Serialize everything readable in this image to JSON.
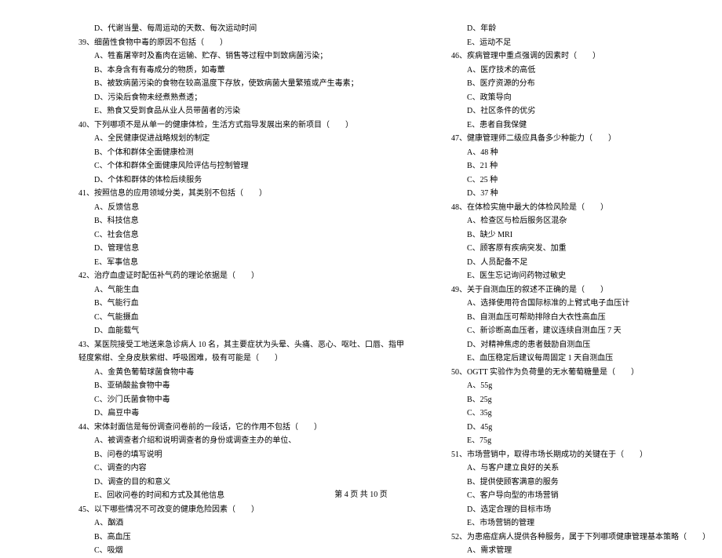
{
  "left": {
    "l0": "D、代谢当量、每周运动的天数、每次运动时间",
    "q39": "39、细菌性食物中毒的原因不包括（　　）",
    "q39a": "A、牲畜屠宰时及畜肉在运输、贮存、销售等过程中到致病菌污染；",
    "q39b": "B、本身含有有毒成分的物质，如毒蕈",
    "q39c": "B、被致病菌污染的食物在较高温度下存放，使致病菌大量繁殖或产生毒素；",
    "q39d": "D、污染后食物未经煮熟煮透；",
    "q39e": "E、熟食又受到食品从业人员带菌者的污染",
    "q40": "40、下列哪项不是从单一的健康体检，生活方式指导发展出来的新项目（　　）",
    "q40a": "A、全民健康促进战略规划的制定",
    "q40b": "B、个体和群体全面健康检测",
    "q40c": "C、个体和群体全面健康风险评估与控制管理",
    "q40d": "D、个体和群体的体检后续服务",
    "q41": "41、按照信息的应用领域分类，其类别不包括（　　）",
    "q41a": "A、反馈信息",
    "q41b": "B、科技信息",
    "q41c": "C、社会信息",
    "q41d": "D、管理信息",
    "q41e": "E、军事信息",
    "q42": "42、治疗血虚证时配伍补气药的理论依据是（　　）",
    "q42a": "A、气能生血",
    "q42b": "B、气能行血",
    "q42c": "C、气能摄血",
    "q42d": "D、血能载气",
    "q43": "43、某医院接受工地送来急诊病人 10 名，其主要症状为头晕、头痛、恶心、呕吐、口唇、指甲",
    "q43cont": "轻度紫绀、全身皮肤紫绀、呼吸困难，极有可能是（　　）",
    "q43a": "A、金黄色葡萄球菌食物中毒",
    "q43b": "B、亚硝酸盐食物中毒",
    "q43c": "C、沙门氏菌食物中毒",
    "q43d": "D、扁豆中毒",
    "q44": "44、宋体封面信是每份调查问卷前的一段话，它的作用不包括（　　）",
    "q44a": "A、被调查者介绍和说明调查者的身份或调查主办的单位、",
    "q44b": "B、问卷的填写说明",
    "q44c": "C、调查的内容",
    "q44d": "D、调查的目的和意义",
    "q44e": "E、回收问卷的时间和方式及其他信息",
    "q45": "45、以下哪些情况不可改变的健康危险因素（　　）",
    "q45a": "A、酗酒",
    "q45b": "B、高血压",
    "q45c": "C、吸烟"
  },
  "right": {
    "r0": "D、年龄",
    "r1": "E、运动不足",
    "q46": "46、疾病管理中重点强调的因素时（　　）",
    "q46a": "A、医疗技术的高低",
    "q46b": "B、医疗资源的分布",
    "q46c": "C、政策导向",
    "q46d": "D、社区条件的优劣",
    "q46e": "E、患者自我保健",
    "q47": "47、健康管理师二级应具备多少种能力（　　）",
    "q47a": "A、48 种",
    "q47b": "B、21 种",
    "q47c": "C、25 种",
    "q47d": "D、37 种",
    "q48": "48、在体检实施中最大的体检风险是（　　）",
    "q48a": "A、检查区与检后服务区混杂",
    "q48b": "B、缺少 MRI",
    "q48c": "C、顾客原有疾病突发、加重",
    "q48d": "D、人员配备不足",
    "q48e": "E、医生忘记询问药物过敏史",
    "q49": "49、关于自测血压的叙述不正确的是（　　）",
    "q49a": "A、选择使用符合国际标准的上臂式电子血压计",
    "q49b": "B、自测血压可帮助排除白大衣性高血压",
    "q49c": "C、新诊断高血压者，建议连续自测血压 7 天",
    "q49d": "D、对精神焦虑的患者鼓励自测血压",
    "q49e": "E、血压稳定后建议每周固定 1 天自测血压",
    "q50": "50、OGTT 实验作为负荷量的无水葡萄糖量是（　　）",
    "q50a": "A、55g",
    "q50b": "B、25g",
    "q50c": "C、35g",
    "q50d": "D、45g",
    "q50e": "E、75g",
    "q51": "51、市场营销中，取得市场长期成功的关键在于（　　）",
    "q51a": "A、与客户建立良好的关系",
    "q51b": "B、提供使顾客满意的服务",
    "q51c": "C、客户导向型的市场营销",
    "q51d": "D、选定合理的目标市场",
    "q51e": "E、市场营销的管理",
    "q52": "52、为患癌症病人提供各种服务，属于下列哪项健康管理基本策略（　　）",
    "q52a": "A、需求管理"
  },
  "footer": "第 4 页 共 10 页"
}
